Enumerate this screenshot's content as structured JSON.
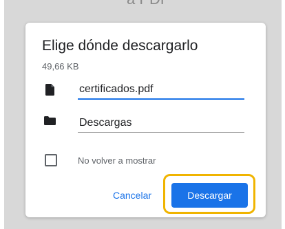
{
  "backdrop": {
    "partial_text": "a PDF"
  },
  "dialog": {
    "title": "Elige dónde descargarlo",
    "file_size": "49,66 KB",
    "filename_value": "certificados.pdf",
    "location_value": "Descargas",
    "dont_show_again_label": "No volver a mostrar",
    "dont_show_again_checked": false,
    "cancel_label": "Cancelar",
    "download_label": "Descargar"
  },
  "icons": {
    "file": "file-icon",
    "folder": "folder-icon"
  },
  "colors": {
    "accent": "#1a73e8",
    "highlight": "#f0b400",
    "backdrop": "#d8d8d8"
  }
}
